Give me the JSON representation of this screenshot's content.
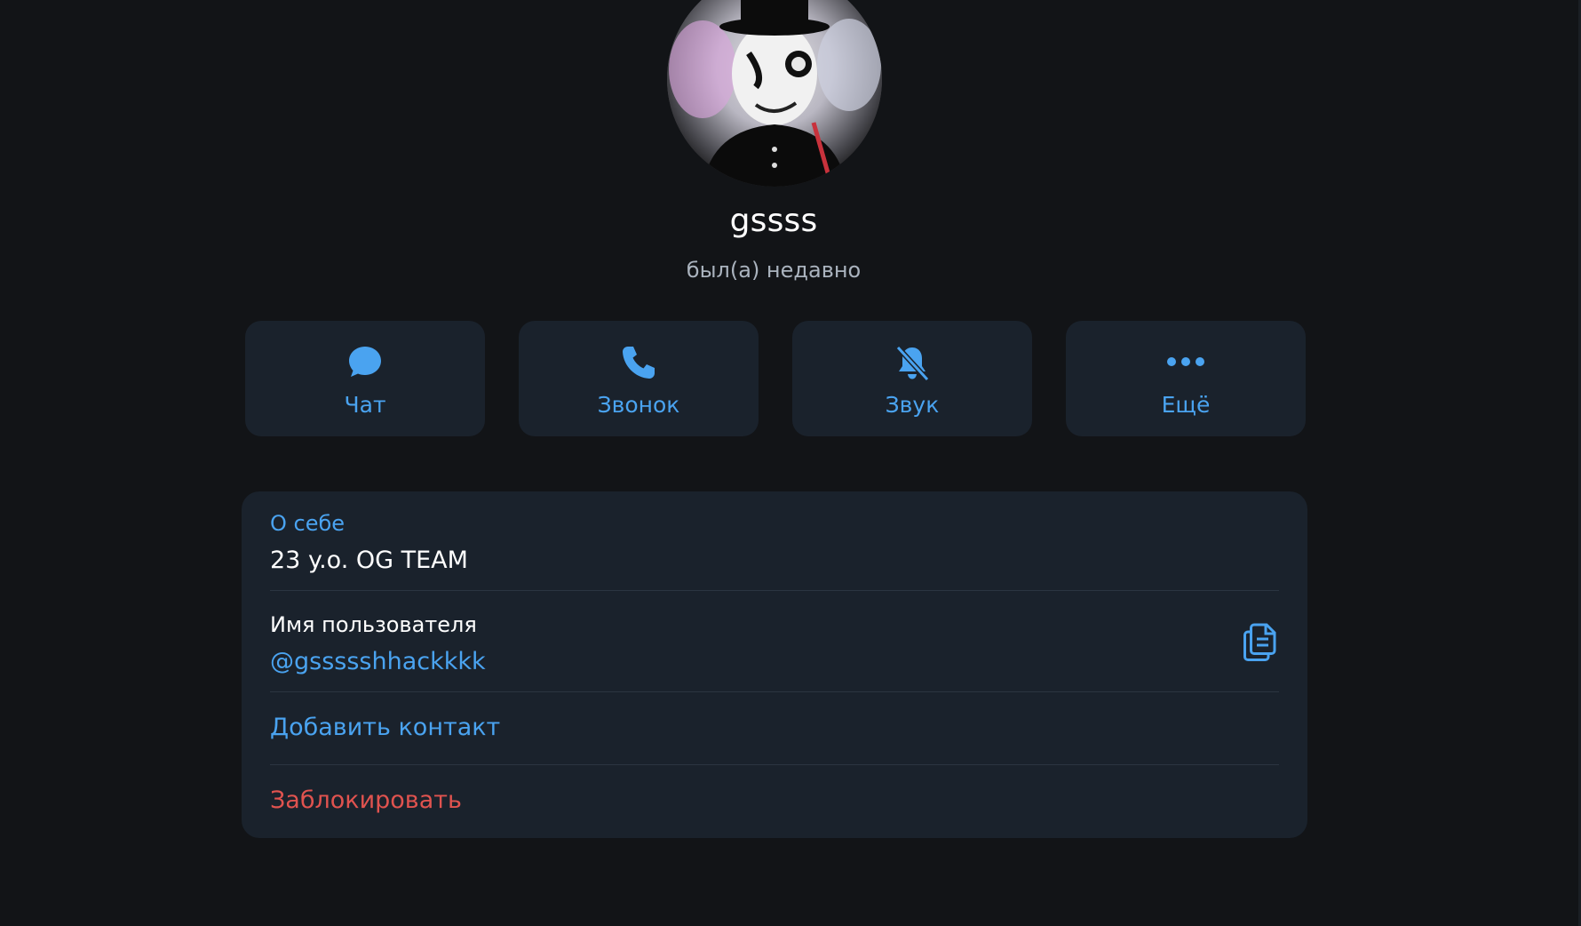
{
  "profile": {
    "name": "gssss",
    "status": "был(а) недавно"
  },
  "actions": [
    {
      "label": "Чат",
      "icon": "chat-bubble-icon"
    },
    {
      "label": "Звонок",
      "icon": "phone-icon"
    },
    {
      "label": "Звук",
      "icon": "bell-muted-icon"
    },
    {
      "label": "Ещё",
      "icon": "more-dots-icon"
    }
  ],
  "info": {
    "about_label": "О себе",
    "about_value": "23 y.o. OG TEAM",
    "username_label": "Имя пользователя",
    "username_value": "@gssssshhackkkk",
    "add_contact": "Добавить контакт",
    "block": "Заблокировать"
  },
  "colors": {
    "background": "#121417",
    "card": "#1a222c",
    "accent": "#4aa3f0",
    "danger": "#e0534f",
    "muted_text": "#aab3be"
  }
}
